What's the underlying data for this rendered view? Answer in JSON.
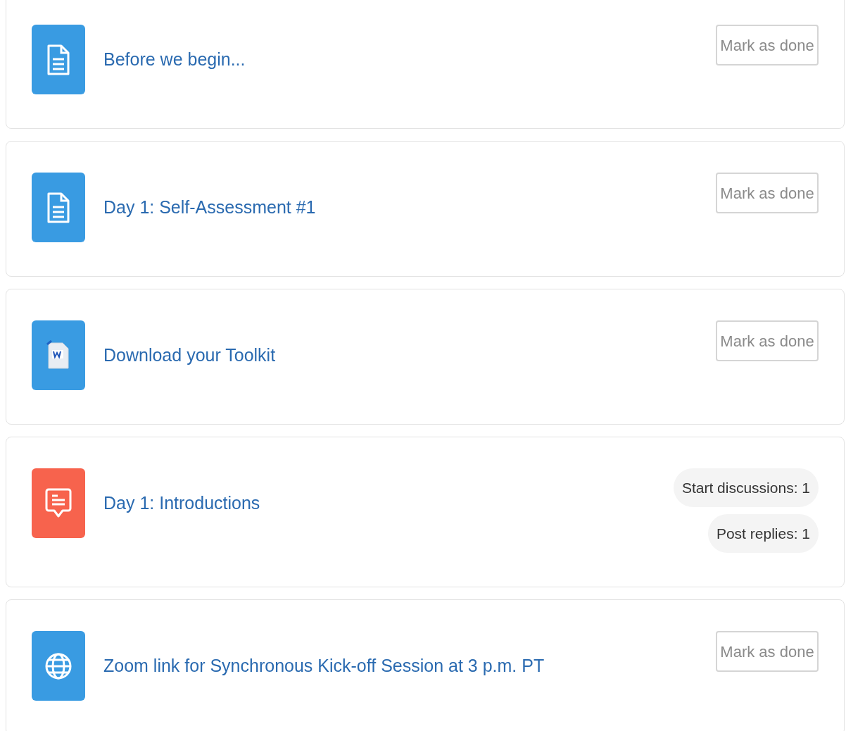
{
  "activities": [
    {
      "kind": "page",
      "title": "Before we begin...",
      "completion": {
        "kind": "manual",
        "label": "Mark as done",
        "done": false
      }
    },
    {
      "kind": "page",
      "title": "Day 1: Self-Assessment #1",
      "completion": {
        "kind": "manual",
        "label": "Mark as done",
        "done": false
      }
    },
    {
      "kind": "file",
      "title": "Download your Toolkit",
      "completion": {
        "kind": "manual",
        "label": "Mark as done",
        "done": false
      }
    },
    {
      "kind": "forum",
      "title": "Day 1: Introductions",
      "completion": {
        "kind": "auto",
        "conditions": [
          "Start discussions: 1",
          "Post replies: 1"
        ]
      }
    },
    {
      "kind": "url",
      "title": "Zoom link for Synchronous Kick-off Session at 3 p.m. PT",
      "completion": {
        "kind": "manual",
        "label": "Mark as done",
        "done": false
      }
    }
  ]
}
